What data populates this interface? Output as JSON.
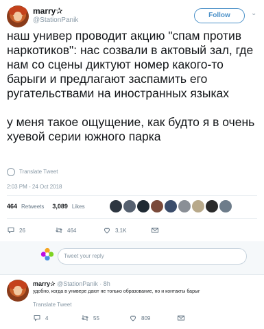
{
  "tweet": {
    "author_name": "marry✰",
    "author_handle": "@StationPanik",
    "follow_label": "Follow",
    "text_paragraphs": [
      "наш универ проводит акцию \"спам против наркотиков\": нас созвали в актовый зал, где нам со сцены диктуют номер какого-то барыги и предлагают заспамить его ругательствами на иностранных языках",
      "у меня такое ощущение, как будто я в очень хуевой серии южного парка"
    ],
    "translate_label": "Translate Tweet",
    "timestamp": "2:03 PM - 24 Oct 2018",
    "retweets_count": "464",
    "retweets_label": "Retweets",
    "likes_count": "3,089",
    "likes_label": "Likes",
    "actions": {
      "replies": "26",
      "retweets": "464",
      "likes": "3,1K"
    }
  },
  "reply_box": {
    "placeholder": "Tweet your reply"
  },
  "reply": {
    "author_name": "marry✰",
    "author_handle": "@StationPanik · 8h",
    "text": "удобно, когда в универе дают не только образование, но и контакты барыг",
    "translate_label": "Translate Tweet",
    "actions": {
      "replies": "4",
      "retweets": "55",
      "likes": "809"
    }
  },
  "colors": {
    "accent": "#4a90c8",
    "muted": "#8899a6",
    "text": "#14171a",
    "like_red": "#e0245e"
  }
}
